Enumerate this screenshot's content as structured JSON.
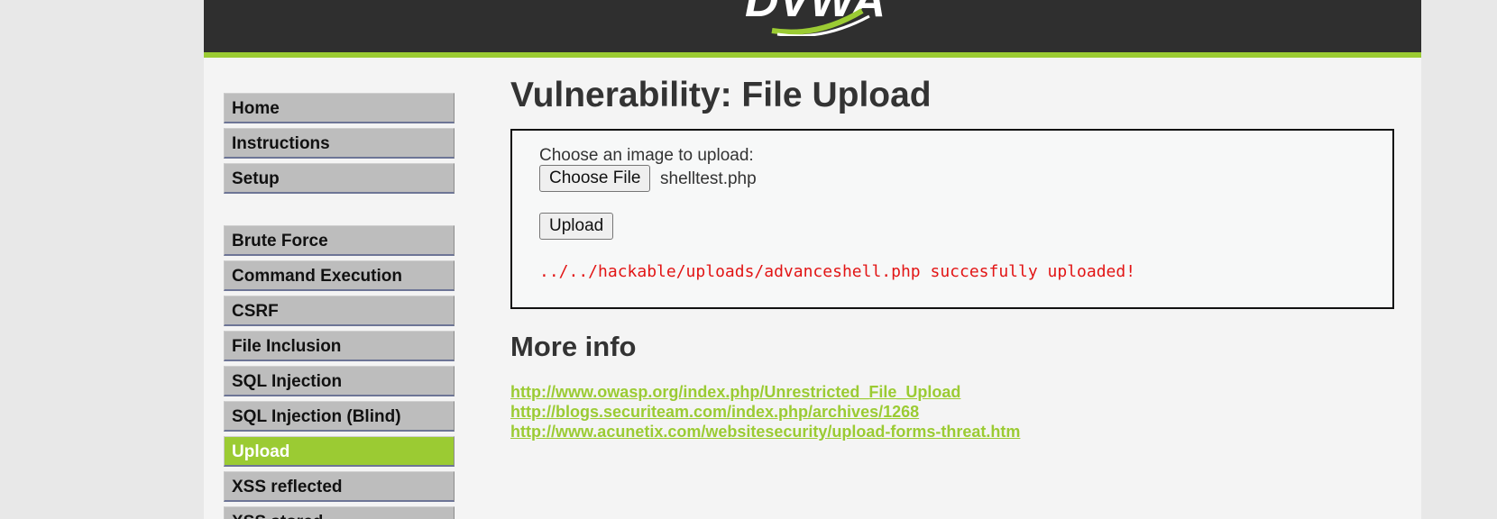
{
  "header": {
    "logo_text": "DVWA"
  },
  "menu": {
    "group1": [
      {
        "label": "Home"
      },
      {
        "label": "Instructions"
      },
      {
        "label": "Setup"
      }
    ],
    "group2": [
      {
        "label": "Brute Force"
      },
      {
        "label": "Command Execution"
      },
      {
        "label": "CSRF"
      },
      {
        "label": "File Inclusion"
      },
      {
        "label": "SQL Injection"
      },
      {
        "label": "SQL Injection (Blind)"
      },
      {
        "label": "Upload",
        "selected": true
      },
      {
        "label": "XSS reflected"
      },
      {
        "label": "XSS stored"
      }
    ]
  },
  "main": {
    "title": "Vulnerability: File Upload",
    "form": {
      "choose_label": "Choose an image to upload:",
      "choose_button": "Choose File",
      "file_name": "shelltest.php",
      "upload_button": "Upload",
      "message": "../../hackable/uploads/advanceshell.php succesfully uploaded!"
    },
    "more_info": {
      "title": "More info",
      "links": [
        "http://www.owasp.org/index.php/Unrestricted_File_Upload",
        "http://blogs.securiteam.com/index.php/archives/1268",
        "http://www.acunetix.com/websitesecurity/upload-forms-threat.htm"
      ]
    }
  },
  "colors": {
    "accent": "#9bcb33",
    "header_bg": "#2f2f2f",
    "menu_bg": "#bdbdbd",
    "error_text": "#e21515"
  }
}
